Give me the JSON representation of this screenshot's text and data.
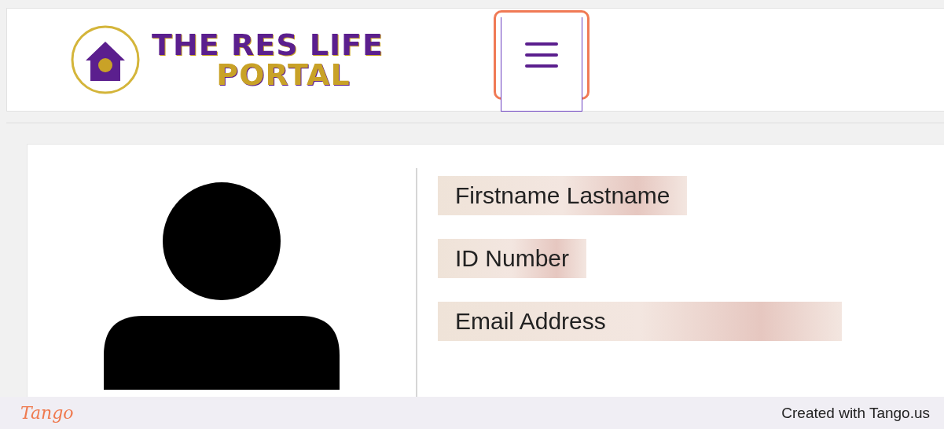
{
  "header": {
    "logo": {
      "line_1": "THE RES LIFE",
      "line_2": "PORTAL"
    },
    "menu_button": {
      "highlighted": true
    }
  },
  "profile": {
    "fields": [
      {
        "text": "Firstname Lastname"
      },
      {
        "text": "ID Number"
      },
      {
        "text": "Email Address"
      }
    ]
  },
  "footer": {
    "brand": "Tango",
    "credit": "Created with Tango.us"
  }
}
